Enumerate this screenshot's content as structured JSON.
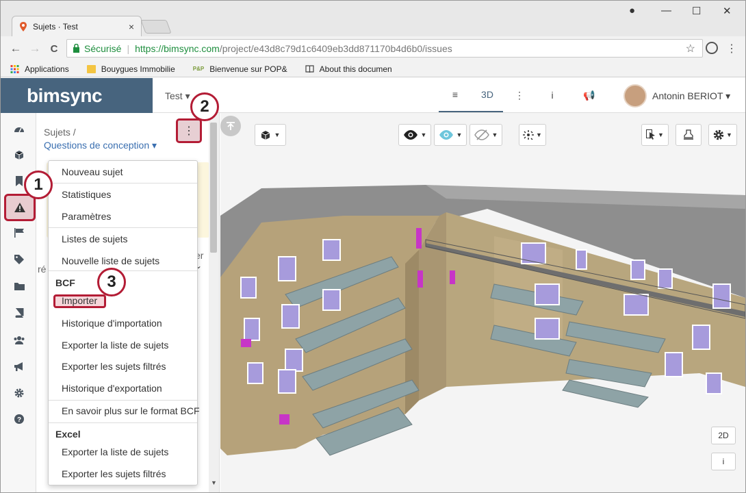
{
  "browser": {
    "tab_title": "Sujets · Test",
    "tab_close": "×",
    "controls": {
      "profile": "●",
      "minimize": "—",
      "maximize": "☐",
      "close": "✕"
    },
    "nav": {
      "back": "←",
      "forward": "→",
      "reload": "C"
    },
    "secure_label": "Sécurisé",
    "url_host": "https://bimsync.com",
    "url_path": "/project/e43d8c79d1c6409eb3dd871170b4d6b0/issues",
    "star": "☆",
    "menu": "⋮",
    "bookmarks": [
      "Applications",
      "Bouygues Immobilie",
      "Bienvenue sur POP&",
      "About this documen"
    ],
    "bookmark_pop_prefix": "P&P"
  },
  "app": {
    "logo": "bimsync",
    "project": "Test ▾",
    "nav": [
      "≡",
      "3D",
      "⋮",
      "i",
      "📢"
    ],
    "user": "Antonin BERIOT ▾"
  },
  "panel": {
    "crumb": "Sujets /",
    "list": "Questions de conception ▾",
    "kebab": "⋮",
    "partial_right": "er",
    "partial_left": "ré"
  },
  "menu": {
    "items_top": [
      "Nouveau sujet",
      "Statistiques",
      "Paramètres",
      "Listes de sujets",
      "Nouvelle liste de sujets"
    ],
    "bcf_head": "BCF",
    "bcf_items": [
      "Importer",
      "Historique d'importation",
      "Exporter la liste de sujets",
      "Exporter les sujets filtrés",
      "Historique d'exportation",
      "En savoir plus sur le format BCF"
    ],
    "excel_head": "Excel",
    "excel_items": [
      "Exporter la liste de sujets",
      "Exporter les sujets filtrés"
    ]
  },
  "callouts": [
    "1",
    "2",
    "3"
  ],
  "viewer": {
    "btn_2d": "2D",
    "btn_info": "i"
  },
  "colors": {
    "accent": "#b31c35",
    "header": "#47647e",
    "link": "#3a6fb0"
  }
}
